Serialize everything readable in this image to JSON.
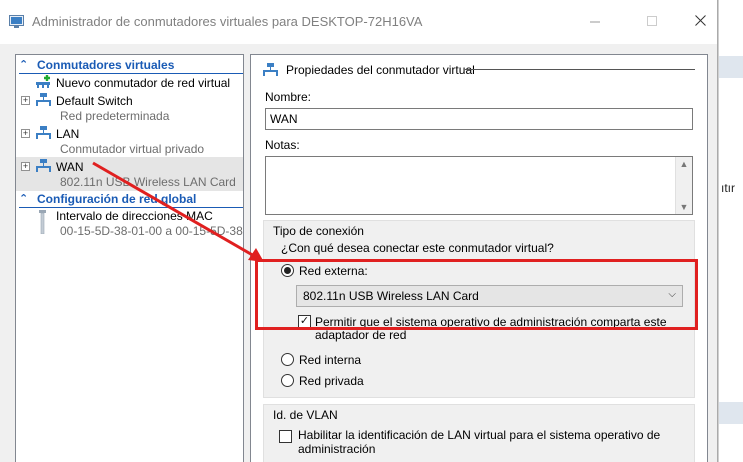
{
  "window": {
    "title": "Administrador de conmutadores virtuales para DESKTOP-72H16VA"
  },
  "left_pane": {
    "section_switches": "Conmutadores virtuales",
    "new_switch": "Nuevo conmutador de red virtual",
    "switches": [
      {
        "name": "Default Switch",
        "sub": "Red predeterminada"
      },
      {
        "name": "LAN",
        "sub": "Conmutador virtual privado"
      },
      {
        "name": "WAN",
        "sub": "802.11n USB Wireless LAN Card"
      }
    ],
    "section_global": "Configuración de red global",
    "mac_range": {
      "name": "Intervalo de direcciones MAC",
      "sub": "00-15-5D-38-01-00 a 00-15-5D-38..."
    }
  },
  "right_pane": {
    "header": "Propiedades del conmutador virtual",
    "name_label": "Nombre:",
    "name_value": "WAN",
    "notes_label": "Notas:",
    "notes_value": "",
    "connection_group": "Tipo de conexión",
    "connection_question": "¿Con qué desea conectar este conmutador virtual?",
    "external_label": "Red externa:",
    "external_selected": true,
    "adapter_value": "802.11n USB Wireless LAN Card",
    "allow_mgmt_label_1": "Permitir que el sistema operativo de administración comparta este",
    "allow_mgmt_label_2": "adaptador de red",
    "allow_mgmt_checked": true,
    "internal_label": "Red interna",
    "private_label": "Red privada",
    "vlan_group": "Id. de VLAN",
    "vlan_label_1": "Habilitar la identificación de LAN virtual para el sistema operativo de",
    "vlan_label_2": "administración",
    "vlan_checked": false
  },
  "background_app": {
    "text": "ıtır"
  },
  "colors": {
    "accent_blue": "#1a5bb5",
    "annotation_red": "#e02020",
    "network_icon_blue": "#3b7fc4"
  }
}
